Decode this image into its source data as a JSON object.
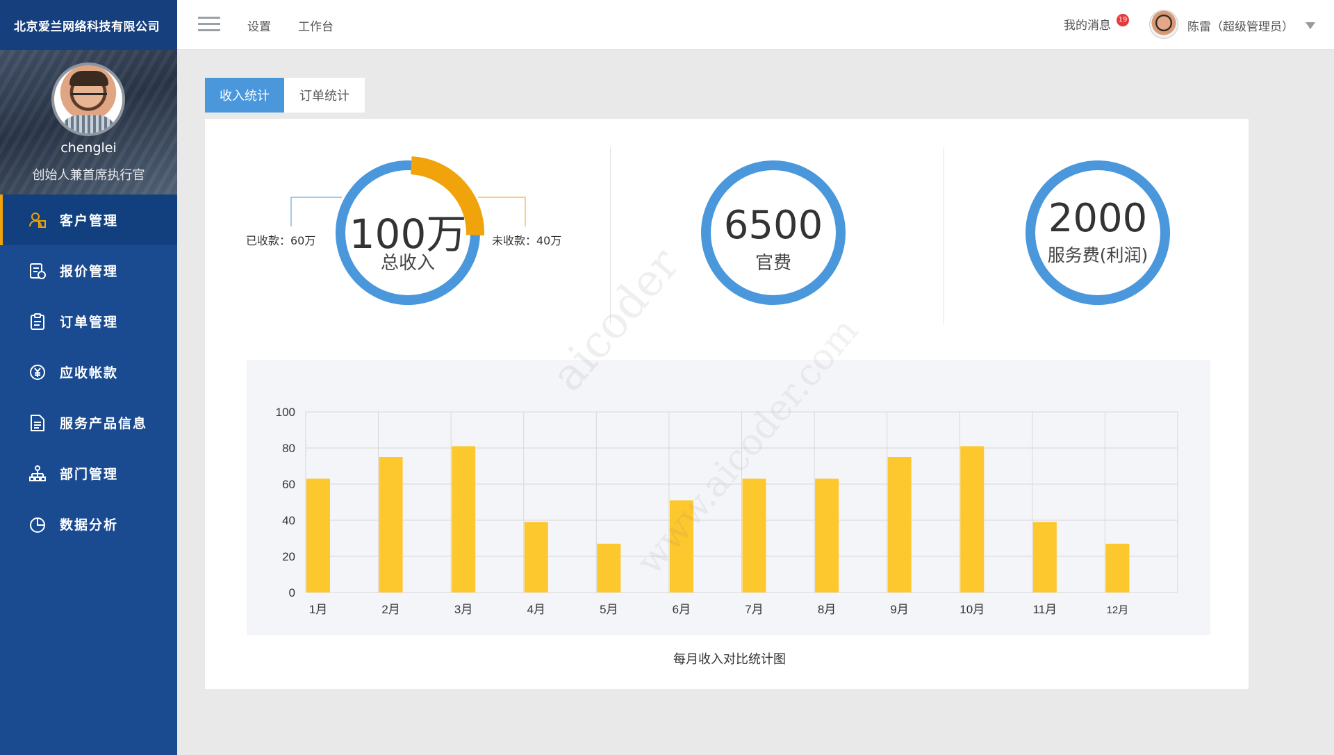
{
  "sidebar": {
    "company": "北京爱兰网络科技有限公司",
    "username": "chenglei",
    "usertitle": "创始人兼首席执行官",
    "items": [
      {
        "label": "客户管理",
        "icon": "customer-icon"
      },
      {
        "label": "报价管理",
        "icon": "quote-icon"
      },
      {
        "label": "订单管理",
        "icon": "clipboard-icon"
      },
      {
        "label": "应收帐款",
        "icon": "yuan-icon"
      },
      {
        "label": "服务产品信息",
        "icon": "document-icon"
      },
      {
        "label": "部门管理",
        "icon": "org-chart-icon"
      },
      {
        "label": "数据分析",
        "icon": "pie-chart-icon"
      }
    ]
  },
  "header": {
    "links": [
      "设置",
      "工作台"
    ],
    "messages_label": "我的消息",
    "messages_count": "19",
    "admin_name": "陈雷（超级管理员）"
  },
  "tabs": [
    {
      "label": "收入统计",
      "active": true
    },
    {
      "label": "订单统计",
      "active": false
    }
  ],
  "stats": {
    "total": {
      "value": "100万",
      "label": "总收入",
      "received_label": "已收款：60万",
      "unreceived_label": "未收款：40万",
      "received_fraction": 0.6,
      "unreceived_fraction": 0.4
    },
    "official": {
      "value": "6500",
      "label": "官费"
    },
    "service": {
      "value": "2000",
      "label": "服务费(利润)"
    }
  },
  "colors": {
    "ring_blue": "#4a97dc",
    "ring_orange": "#f0a30a",
    "bar_yellow": "#fdc72e",
    "sidebar": "#1a4a90",
    "accent": "#f0a30a"
  },
  "watermark": {
    "line1": "aicoder",
    "line2": "www.aicoder.com"
  },
  "chart_data": {
    "type": "bar",
    "title": "每月收入对比统计图",
    "categories": [
      "1月",
      "2月",
      "3月",
      "4月",
      "5月",
      "6月",
      "7月",
      "8月",
      "9月",
      "10月",
      "11月",
      "12月"
    ],
    "values": [
      63,
      75,
      81,
      39,
      27,
      51,
      63,
      63,
      75,
      81,
      39,
      27
    ],
    "ylim": [
      0,
      100
    ],
    "yticks": [
      0,
      20,
      40,
      60,
      80,
      100
    ],
    "grid": true
  }
}
